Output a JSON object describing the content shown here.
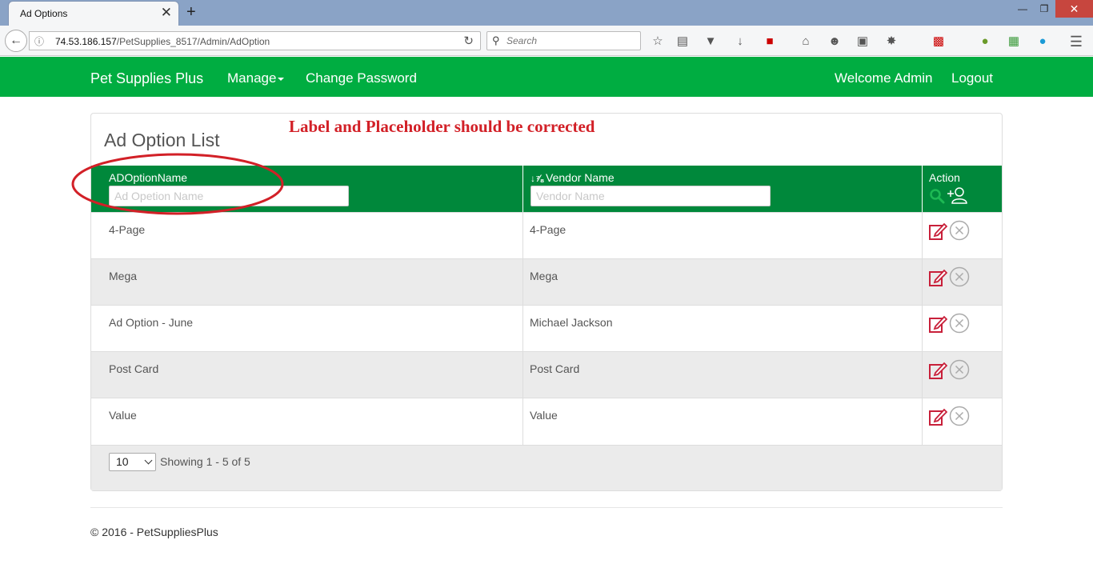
{
  "browser": {
    "tab_title": "Ad Options",
    "tab_close": "✕",
    "new_tab": "+",
    "url_host": "74.53.186.157",
    "url_path": "/PetSupplies_8517/Admin/AdOption",
    "search_placeholder": "Search"
  },
  "nav": {
    "brand": "Pet Supplies Plus",
    "manage": "Manage",
    "change_password": "Change Password",
    "welcome": "Welcome Admin",
    "logout": "Logout"
  },
  "panel": {
    "title": "Ad Option List",
    "annotation": "Label and Placeholder should be corrected"
  },
  "table": {
    "columns": {
      "name_label": "ADOptionName",
      "name_placeholder": "Ad Opetion Name",
      "vendor_label": "Vendor Name",
      "vendor_placeholder": "Vendor Name",
      "action_label": "Action"
    },
    "rows": [
      {
        "name": "4-Page",
        "vendor": "4-Page"
      },
      {
        "name": "Mega",
        "vendor": "Mega"
      },
      {
        "name": "Ad Option - June",
        "vendor": "Michael Jackson"
      },
      {
        "name": "Post Card",
        "vendor": "Post Card"
      },
      {
        "name": "Value",
        "vendor": "Value"
      }
    ]
  },
  "pager": {
    "page_size": "10",
    "showing": "Showing 1 - 5 of 5"
  },
  "footer": {
    "copyright": "© 2016 - PetSuppliesPlus"
  },
  "colors": {
    "nav_green": "#00ad41",
    "header_green": "#00883b",
    "annotation_red": "#d22027",
    "edit_icon": "#c8203a"
  }
}
